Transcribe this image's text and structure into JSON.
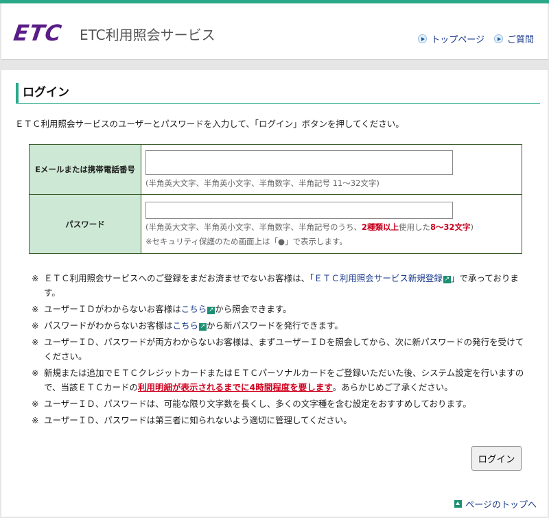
{
  "header": {
    "logo_text": "ETC",
    "site_name": "ETC利用照会サービス",
    "links": {
      "top_page": "トップページ",
      "faq": "ご質問"
    }
  },
  "page": {
    "title": "ログイン",
    "intro": "ＥＴＣ利用照会サービスのユーザーとパスワードを入力して、「ログイン」ボタンを押してください。"
  },
  "form": {
    "user": {
      "label": "Eメールまたは携帯電話番号",
      "value": "",
      "hint": "(半角英大文字、半角英小文字、半角数字、半角記号 11～32文字)"
    },
    "password": {
      "label": "パスワード",
      "value": "",
      "hint_a": "(半角英大文字、半角英小文字、半角数字、半角記号のうち、",
      "hint_b": "2種類以上",
      "hint_c": "使用した",
      "hint_d": "8～32文字",
      "hint_e": ")",
      "security_note": "※セキュリティ保護のため画面上は「●」で表示します。"
    },
    "submit_label": "ログイン"
  },
  "notes": {
    "mark": "※",
    "n1": {
      "a": "ＥＴＣ利用照会サービスへのご登録をまだお済ませでないお客様は、「",
      "link": "ＥＴＣ利用照会サービス新規登録",
      "b": "」で承っております。"
    },
    "n2": {
      "a": "ユーザーＩＤがわからないお客様は",
      "link": "こちら",
      "b": "から照会できます。"
    },
    "n3": {
      "a": "パスワードがわからないお客様は",
      "link": "こちら",
      "b": "から新パスワードを発行できます。"
    },
    "n4": "ユーザーＩＤ、パスワードが両方わからないお客様は、まずユーザーＩＤを照会してから、次に新パスワードの発行を受けてください。",
    "n5": {
      "a": "新規または追加でＥＴＣクレジットカードまたはＥＴＣパーソナルカードをご登録いただいた後、システム設定を行いますので、当該ＥＴＣカードの",
      "emph": "利用明細が表示されるまでに4時間程度を要します",
      "b": "。あらかじめご了承ください。"
    },
    "n6": "ユーザーＩＤ、パスワードは、可能な限り文字数を長くし、多くの文字種を含む設定をおすすめしております。",
    "n7": "ユーザーＩＤ、パスワードは第三者に知られないよう適切に管理してください。"
  },
  "footer": {
    "page_top": "ページのトップへ"
  },
  "icons": {
    "header_links": "arrow-right-circle-icon",
    "notes_links": "external-link-icon",
    "page_top": "arrow-up-icon"
  },
  "colors": {
    "accent": "#2aa98a",
    "logo": "#5a1d86",
    "link": "#1a3a8c",
    "warning": "#c8001e"
  }
}
